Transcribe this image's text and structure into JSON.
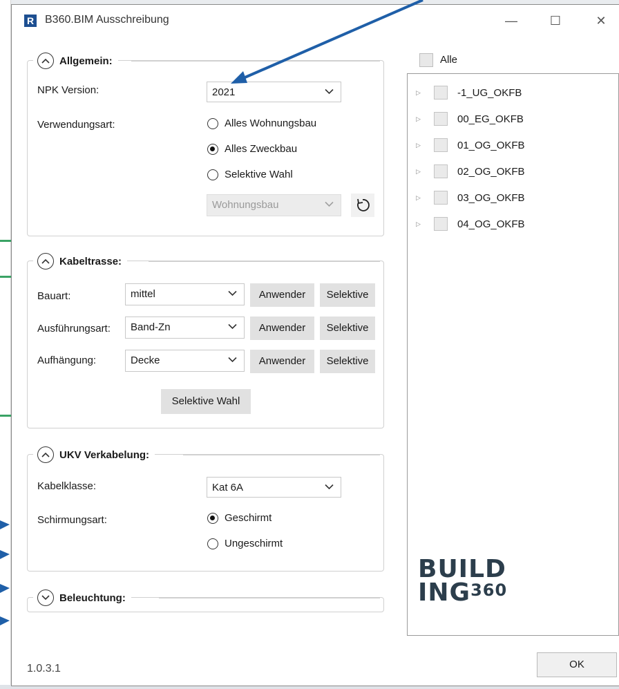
{
  "window": {
    "app_icon": "R",
    "title": "B360.BIM Ausschreibung",
    "minimize": "—",
    "maximize": "☐",
    "close": "✕"
  },
  "allgemein": {
    "title": "Allgemein:",
    "npk_label": "NPK Version:",
    "npk_value": "2021",
    "verwendung_label": "Verwendungsart:",
    "options": [
      "Alles Wohnungsbau",
      "Alles Zweckbau",
      "Selektive Wahl"
    ],
    "selected_option": "Alles Zweckbau",
    "selective_combo": "Wohnungsbau"
  },
  "kabeltrasse": {
    "title": "Kabeltrasse:",
    "rows": [
      {
        "label": "Bauart:",
        "value": "mittel",
        "apply": "Anwender",
        "select": "Selektive"
      },
      {
        "label": "Ausführungsart:",
        "value": "Band-Zn",
        "apply": "Anwender",
        "select": "Selektive"
      },
      {
        "label": "Aufhängung:",
        "value": "Decke",
        "apply": "Anwender",
        "select": "Selektive"
      }
    ],
    "selective_button": "Selektive Wahl"
  },
  "ukv": {
    "title": "UKV Verkabelung:",
    "kabelklasse_label": "Kabelklasse:",
    "kabelklasse_value": "Kat 6A",
    "schirmung_label": "Schirmungsart:",
    "options": [
      "Geschirmt",
      "Ungeschirmt"
    ],
    "selected_option": "Geschirmt"
  },
  "beleuchtung": {
    "title": "Beleuchtung:"
  },
  "levels": {
    "all_label": "Alle",
    "items": [
      "-1_UG_OKFB",
      "00_EG_OKFB",
      "01_OG_OKFB",
      "02_OG_OKFB",
      "03_OG_OKFB",
      "04_OG_OKFB"
    ]
  },
  "logo": {
    "line1": "BUILD",
    "line2": "ING",
    "line2_sup": "360"
  },
  "footer": {
    "version": "1.0.3.1",
    "ok": "OK"
  },
  "colors": {
    "annotation_arrow": "#1f5fa8",
    "annotation_line": "#3aa365",
    "logo": "#2c3e4c"
  }
}
